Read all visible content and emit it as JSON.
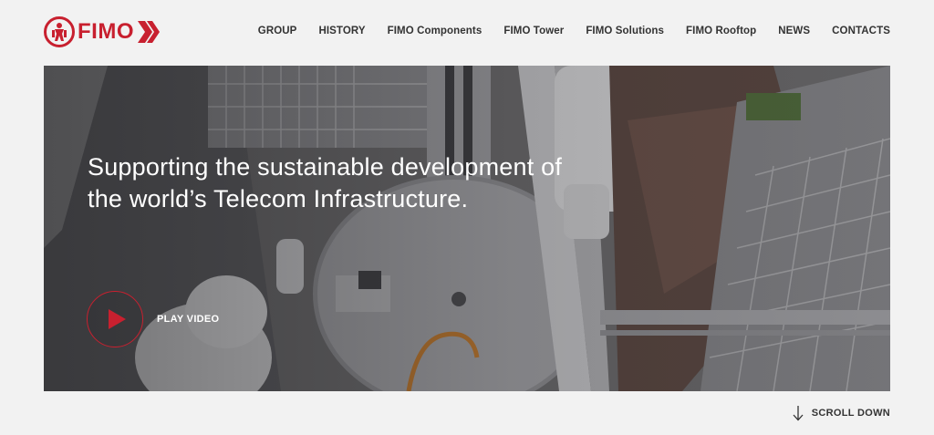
{
  "brand": {
    "name": "FIMO",
    "color": "#c8202f"
  },
  "nav": {
    "items": [
      {
        "label": "GROUP"
      },
      {
        "label": "HISTORY"
      },
      {
        "label": "FIMO Components"
      },
      {
        "label": "FIMO Tower"
      },
      {
        "label": "FIMO Solutions"
      },
      {
        "label": "FIMO Rooftop"
      },
      {
        "label": "NEWS"
      },
      {
        "label": "CONTACTS"
      }
    ]
  },
  "hero": {
    "headline_line1": "Supporting the sustainable development of",
    "headline_line2": "the world’s Telecom Infrastructure.",
    "play_label": "PLAY VIDEO",
    "play_icon": "play-icon"
  },
  "footer": {
    "scroll_label": "SCROLL DOWN",
    "scroll_icon": "arrow-down-icon"
  }
}
